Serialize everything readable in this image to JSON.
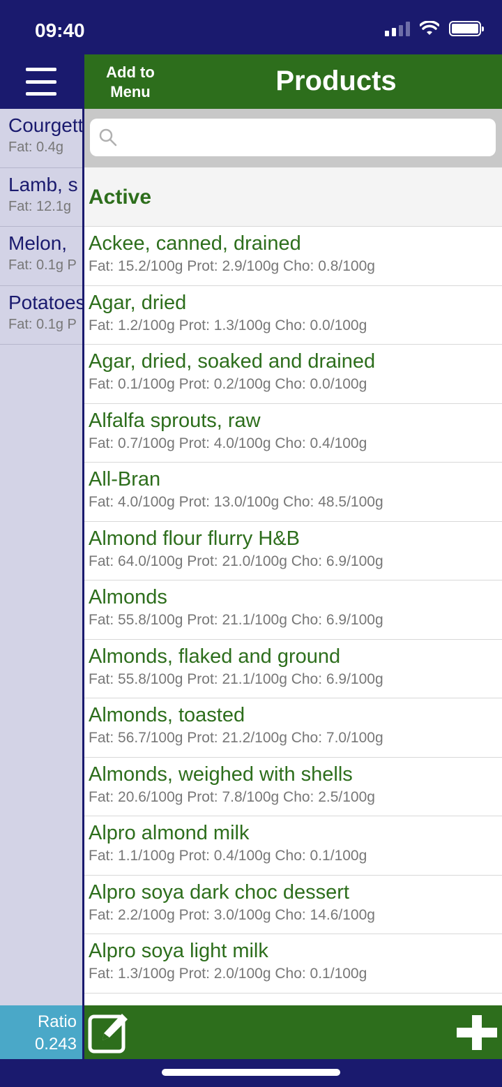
{
  "status_bar": {
    "time": "09:40"
  },
  "nav": {
    "add_to_menu_line1": "Add to",
    "add_to_menu_line2": "Menu",
    "title": "Products"
  },
  "search": {
    "placeholder": "",
    "value": ""
  },
  "section_header": "Active",
  "menu_items": [
    {
      "name": "Courgette",
      "info": "Fat: 0.4g"
    },
    {
      "name": "Lamb, s",
      "info": "Fat: 12.1g"
    },
    {
      "name": "Melon,",
      "info": "Fat: 0.1g P"
    },
    {
      "name": "Potatoes",
      "info": "Fat: 0.1g P"
    }
  ],
  "ratio": {
    "label": "Ratio",
    "value": "0.243"
  },
  "products": [
    {
      "name": "Ackee, canned, drained",
      "info": "Fat: 15.2/100g Prot: 2.9/100g Cho: 0.8/100g"
    },
    {
      "name": "Agar, dried",
      "info": "Fat: 1.2/100g Prot: 1.3/100g Cho: 0.0/100g"
    },
    {
      "name": "Agar, dried, soaked and drained",
      "info": "Fat: 0.1/100g Prot: 0.2/100g Cho: 0.0/100g"
    },
    {
      "name": "Alfalfa sprouts, raw",
      "info": "Fat: 0.7/100g Prot: 4.0/100g Cho: 0.4/100g"
    },
    {
      "name": "All-Bran",
      "info": "Fat: 4.0/100g Prot: 13.0/100g Cho: 48.5/100g"
    },
    {
      "name": "Almond flour flurry H&B",
      "info": "Fat: 64.0/100g Prot: 21.0/100g Cho: 6.9/100g"
    },
    {
      "name": "Almonds",
      "info": "Fat: 55.8/100g Prot: 21.1/100g Cho: 6.9/100g"
    },
    {
      "name": "Almonds, flaked and ground",
      "info": "Fat: 55.8/100g Prot: 21.1/100g Cho: 6.9/100g"
    },
    {
      "name": "Almonds, toasted",
      "info": "Fat: 56.7/100g Prot: 21.2/100g Cho: 7.0/100g"
    },
    {
      "name": "Almonds, weighed with shells",
      "info": "Fat: 20.6/100g Prot: 7.8/100g Cho: 2.5/100g"
    },
    {
      "name": "Alpro almond milk",
      "info": "Fat: 1.1/100g Prot: 0.4/100g Cho: 0.1/100g"
    },
    {
      "name": "Alpro soya dark choc dessert",
      "info": "Fat: 2.2/100g Prot: 3.0/100g Cho: 14.6/100g"
    },
    {
      "name": "Alpro soya light milk",
      "info": "Fat: 1.3/100g Prot: 2.0/100g Cho: 0.1/100g"
    }
  ],
  "colors": {
    "navy": "#1a1a6e",
    "green": "#2d6e1c",
    "ratio_bg": "#4aa8c8",
    "menu_bg": "#d3d3e6"
  }
}
